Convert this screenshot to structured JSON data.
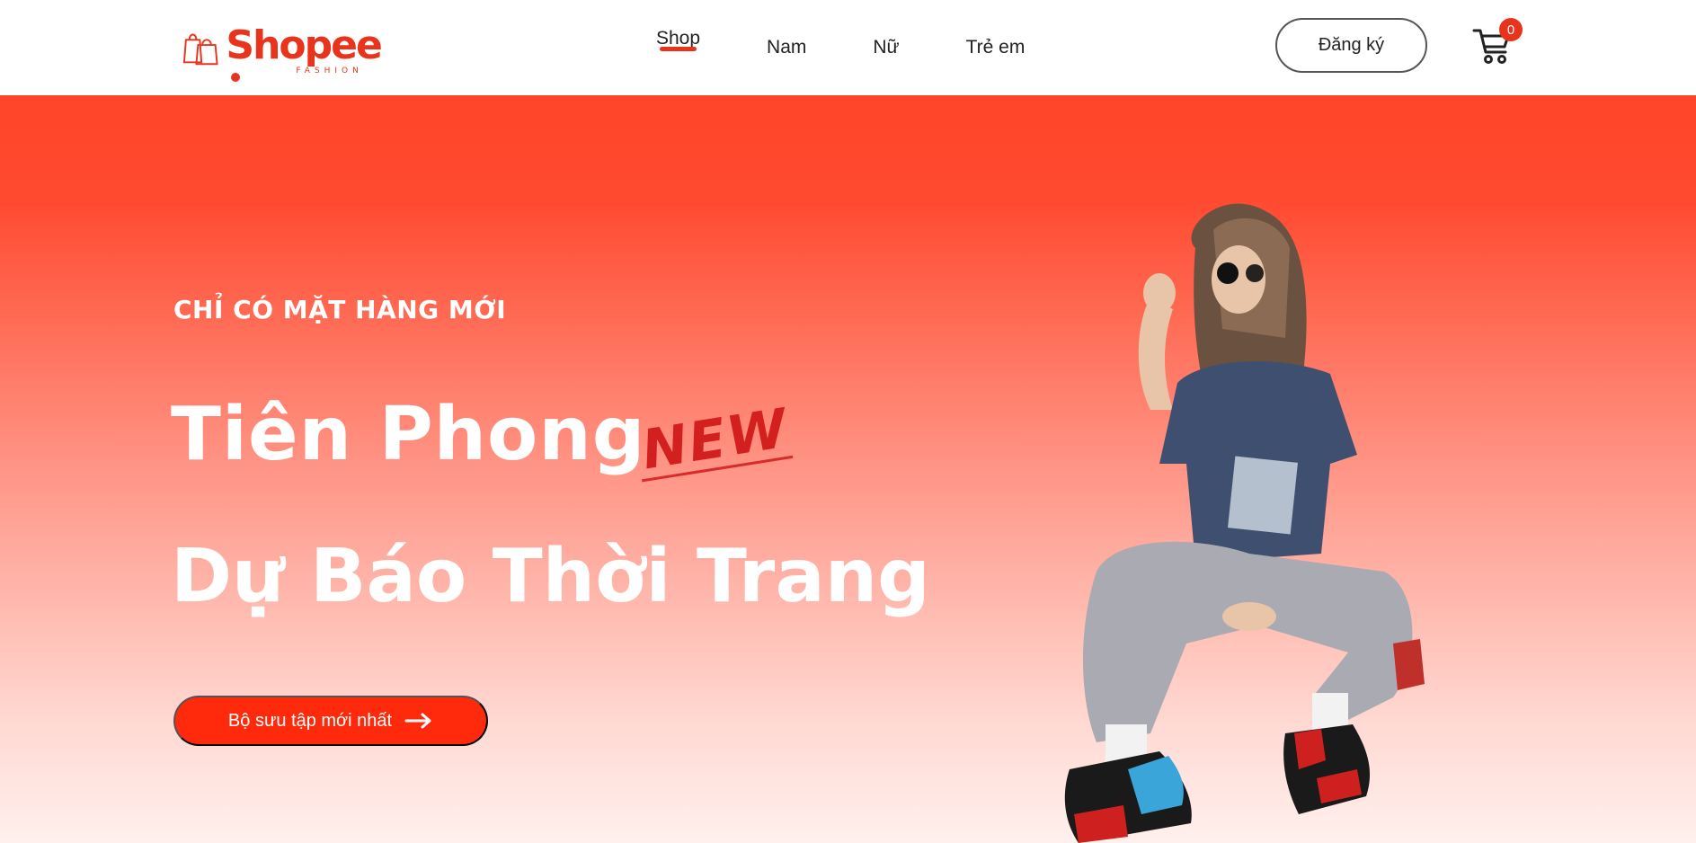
{
  "brand": {
    "name": "Shopee",
    "sub": "FASHION",
    "color": "#e8341c"
  },
  "nav": {
    "items": [
      {
        "label": "Shop",
        "active": true
      },
      {
        "label": "Nam",
        "active": false
      },
      {
        "label": "Nữ",
        "active": false
      },
      {
        "label": "Trẻ em",
        "active": false
      }
    ]
  },
  "header": {
    "signup_label": "Đăng ký",
    "cart_count": "0"
  },
  "hero": {
    "eyebrow": "CHỈ CÓ MẶT HÀNG MỚI",
    "headline_line1": "Tiên Phong",
    "stamp": "NEW",
    "headline_line2": "Dự Báo Thời Trang",
    "cta_label": "Bộ sưu tập mới nhất",
    "accent_color": "#ff2a0c"
  },
  "icons": {
    "logo": "shopping-bags-icon",
    "cart": "shopping-cart-icon",
    "cta": "arrow-right-icon"
  }
}
